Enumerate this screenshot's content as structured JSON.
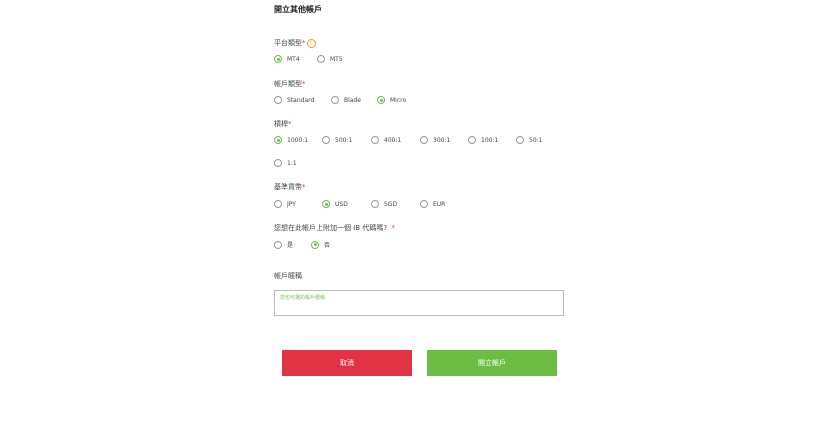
{
  "form_title": "開立其他帳戶",
  "platform": {
    "label": "平台類型",
    "required_mark": "*",
    "info_icon": "!",
    "options": [
      "MT4",
      "MT5"
    ],
    "selected": "MT4"
  },
  "account_type": {
    "label": "帳戶類型",
    "required_mark": "*",
    "options": [
      "Standard",
      "Blade",
      "Micro"
    ],
    "selected": "Micro"
  },
  "leverage": {
    "label": "槓桿",
    "required_mark": "*",
    "options": [
      "1000:1",
      "500:1",
      "400:1",
      "300:1",
      "100:1",
      "50:1",
      "1:1"
    ],
    "selected": "1000:1"
  },
  "base_currency": {
    "label": "基準貨幣",
    "required_mark": "*",
    "options": [
      "JPY",
      "USD",
      "SGD",
      "EUR"
    ],
    "selected": "USD"
  },
  "ib_code": {
    "label": "您想在此帳戶上附加一個 IB 代碼嗎?",
    "required_mark": "*",
    "options": [
      "是",
      "否"
    ],
    "selected": "否"
  },
  "nickname": {
    "label": "帳戶暱稱",
    "placeholder": "您也可選的帳戶暱稱"
  },
  "buttons": {
    "cancel": "取消",
    "open_account": "開立帳戶"
  },
  "colors": {
    "accent_green": "#6dbd45",
    "cancel_red": "#e03444",
    "required_red": "#e53344",
    "info_orange": "#f39c12"
  }
}
